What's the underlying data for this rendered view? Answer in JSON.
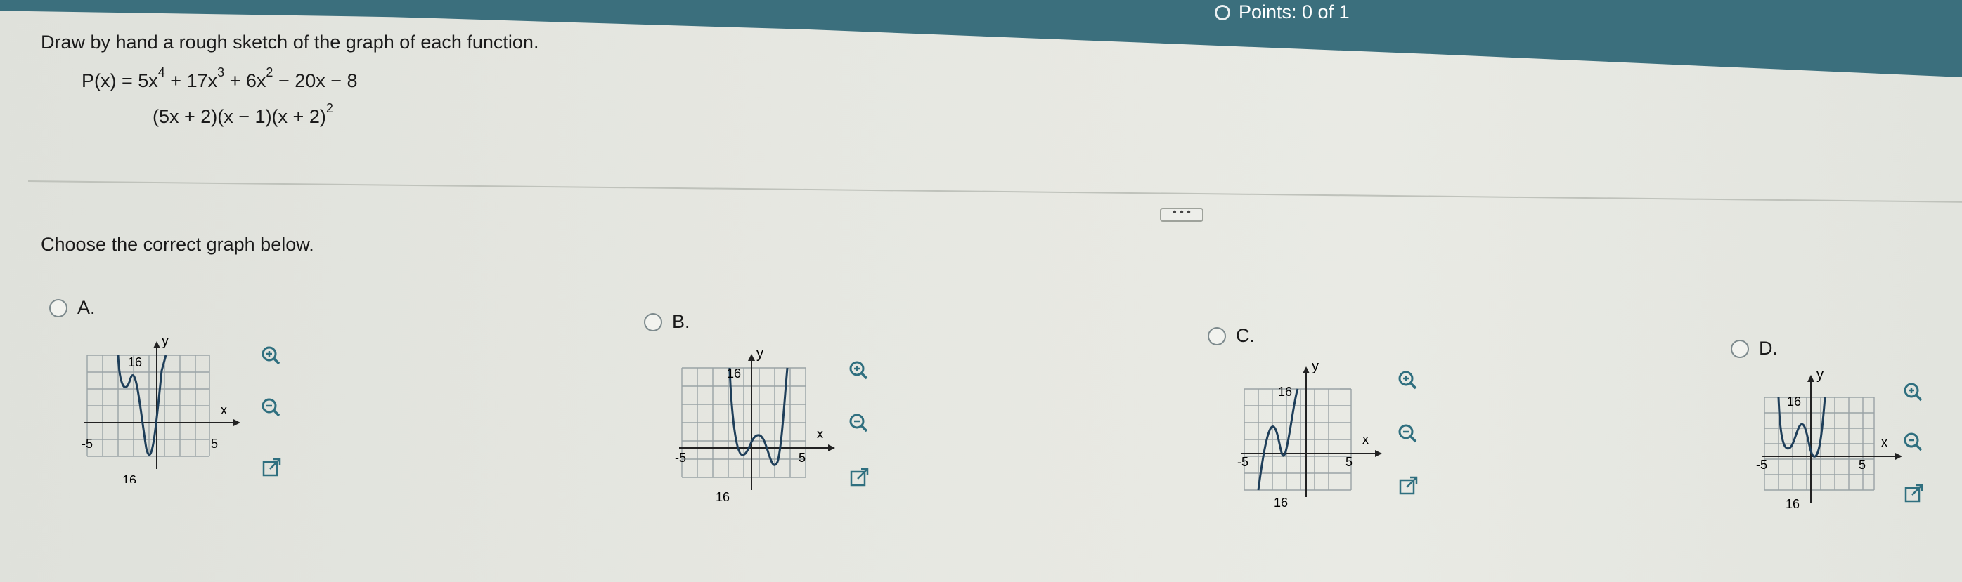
{
  "header": {
    "points": "Points: 0 of 1"
  },
  "question": {
    "instruction": "Draw by hand a rough sketch of the graph of each function.",
    "function_expanded": {
      "lhs": "P(x) = 5x",
      "e1": "4",
      "t2": " + 17x",
      "e2": "3",
      "t3": " + 6x",
      "e3": "2",
      "t4": " − 20x − 8"
    },
    "function_factored": {
      "base": "(5x + 2)(x − 1)(x + 2)",
      "exp": "2"
    },
    "more_button": "• • •",
    "prompt": "Choose the correct graph below."
  },
  "options": [
    {
      "label": "A.",
      "axes": {
        "y": "y",
        "x": "x",
        "ymax": "16",
        "ymin": "16",
        "xmin": "-5",
        "xmax": "5"
      }
    },
    {
      "label": "B.",
      "axes": {
        "y": "y",
        "x": "x",
        "ymax": "16",
        "ymin": "16",
        "xmin": "-5",
        "xmax": "5"
      }
    },
    {
      "label": "C.",
      "axes": {
        "y": "y",
        "x": "x",
        "ymax": "16",
        "ymin": "16",
        "xmin": "-5",
        "xmax": "5"
      }
    },
    {
      "label": "D.",
      "axes": {
        "y": "y",
        "x": "x",
        "ymax": "16",
        "ymin": "16",
        "xmin": "-5",
        "xmax": "5"
      }
    }
  ],
  "colors": {
    "header": "#3b6f7d",
    "graph_curve": "#1f3f5a",
    "grid": "#9aa3a6",
    "tool_icon": "#2f6f7f"
  },
  "icons": [
    "zoom-in-icon",
    "zoom-out-icon",
    "open-external-icon"
  ]
}
